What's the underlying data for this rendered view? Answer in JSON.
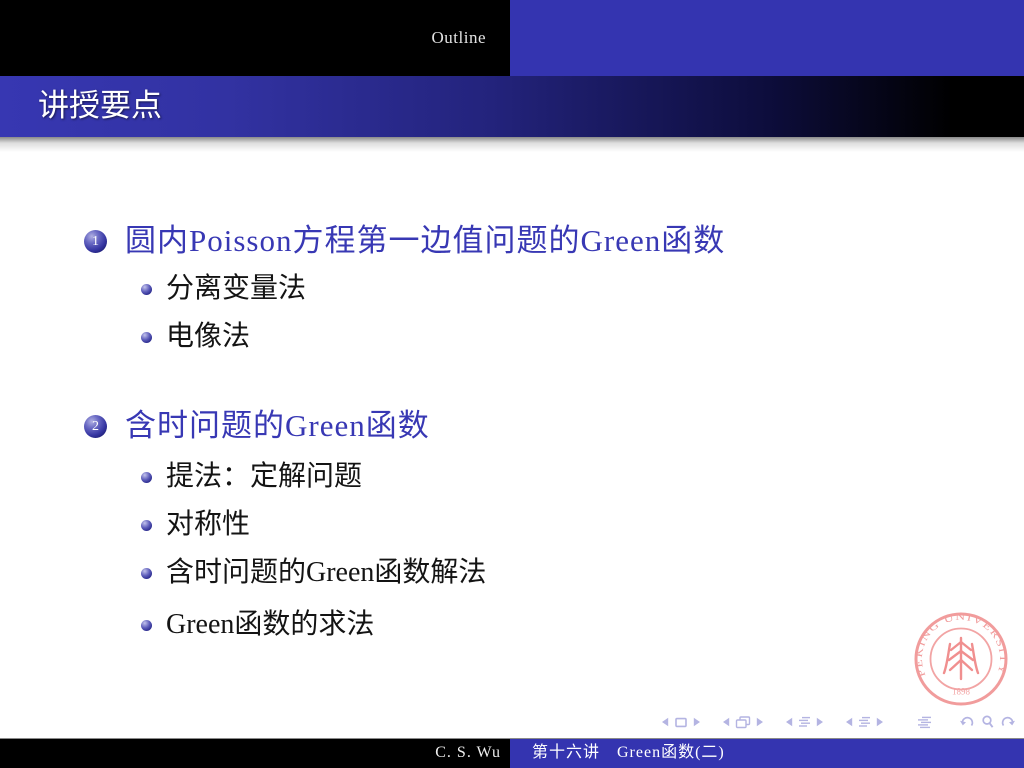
{
  "header": {
    "section_label": "Outline",
    "frametitle": "讲授要点"
  },
  "outline": {
    "items": [
      {
        "number": "1",
        "label": "圆内Poisson方程第一边值问题的Green函数",
        "subitems": [
          "分离变量法",
          "电像法"
        ]
      },
      {
        "number": "2",
        "label": "含时问题的Green函数",
        "subitems": [
          "提法：定解问题",
          "对称性",
          "含时问题的Green函数解法",
          "Green函数的求法"
        ]
      }
    ]
  },
  "footer": {
    "author": "C. S. Wu",
    "lecture_title": "第十六讲　Green函数(二)"
  },
  "logo": {
    "arc_text": "PEKING UNIVERSITY",
    "year": "1898"
  },
  "nav_symbols": [
    "prev-slide",
    "slide",
    "next-slide",
    "prev-frame",
    "frame",
    "next-frame",
    "prev-subsection",
    "subsection",
    "next-subsection",
    "prev-section",
    "section",
    "next-section",
    "presentation",
    "back",
    "find",
    "forward"
  ],
  "colors": {
    "structure_blue": "#3434b0",
    "seal_pink": "#f19c9c",
    "nav_lavender": "#b4b4e2"
  }
}
